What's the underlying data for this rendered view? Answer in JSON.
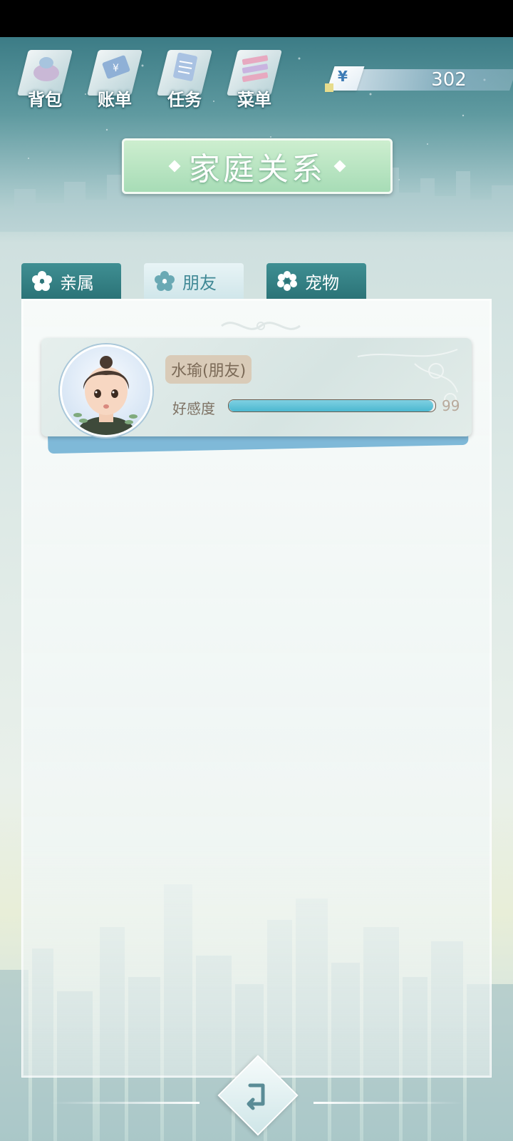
{
  "nav": {
    "items": [
      {
        "label": "背包",
        "icon": "backpack-icon"
      },
      {
        "label": "账单",
        "icon": "bill-icon"
      },
      {
        "label": "任务",
        "icon": "task-list-icon"
      },
      {
        "label": "菜单",
        "icon": "menu-icon"
      }
    ]
  },
  "currency": {
    "symbol": "¥",
    "amount": "302"
  },
  "page_title": "家庭关系",
  "tabs": [
    {
      "label": "亲属",
      "icon": "flower-icon"
    },
    {
      "label": "朋友",
      "icon": "flower-icon",
      "selected": true
    },
    {
      "label": "宠物",
      "icon": "flower-icon"
    }
  ],
  "friend": {
    "name": "水瑜(朋友)",
    "affinity_label": "好感度",
    "affinity_value": "99",
    "affinity_fraction": 0.99
  },
  "colors": {
    "accent": "#4bb8d0",
    "tab_active_text": "#3f8895",
    "tab_inactive_bg": "#2b7377"
  }
}
